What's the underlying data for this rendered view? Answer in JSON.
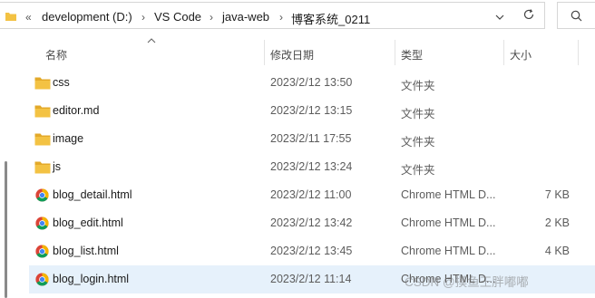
{
  "breadcrumb": {
    "overflow": "«",
    "items": [
      "development (D:)",
      "VS Code",
      "java-web",
      "博客系统_0211"
    ]
  },
  "columns": {
    "name": "名称",
    "modified": "修改日期",
    "type": "类型",
    "size": "大小"
  },
  "files": [
    {
      "name": "css",
      "modified": "2023/2/12 13:50",
      "type": "文件夹",
      "size": "",
      "icon": "folder-icon"
    },
    {
      "name": "editor.md",
      "modified": "2023/2/12 13:15",
      "type": "文件夹",
      "size": "",
      "icon": "folder-icon"
    },
    {
      "name": "image",
      "modified": "2023/2/11 17:55",
      "type": "文件夹",
      "size": "",
      "icon": "folder-icon"
    },
    {
      "name": "js",
      "modified": "2023/2/12 13:24",
      "type": "文件夹",
      "size": "",
      "icon": "folder-icon"
    },
    {
      "name": "blog_detail.html",
      "modified": "2023/2/12 11:00",
      "type": "Chrome HTML D...",
      "size": "7 KB",
      "icon": "chrome-icon"
    },
    {
      "name": "blog_edit.html",
      "modified": "2023/2/12 13:42",
      "type": "Chrome HTML D...",
      "size": "2 KB",
      "icon": "chrome-icon"
    },
    {
      "name": "blog_list.html",
      "modified": "2023/2/12 13:45",
      "type": "Chrome HTML D...",
      "size": "4 KB",
      "icon": "chrome-icon"
    },
    {
      "name": "blog_login.html",
      "modified": "2023/2/12 11:14",
      "type": "Chrome HTML D...",
      "size": "",
      "icon": "chrome-icon"
    }
  ],
  "watermark": "CSDN @摸鱼王胖嘟嘟",
  "colors": {
    "selected_row": "#e6f1fb",
    "folder": "#f3c243",
    "folder_dark": "#e3a92a"
  }
}
